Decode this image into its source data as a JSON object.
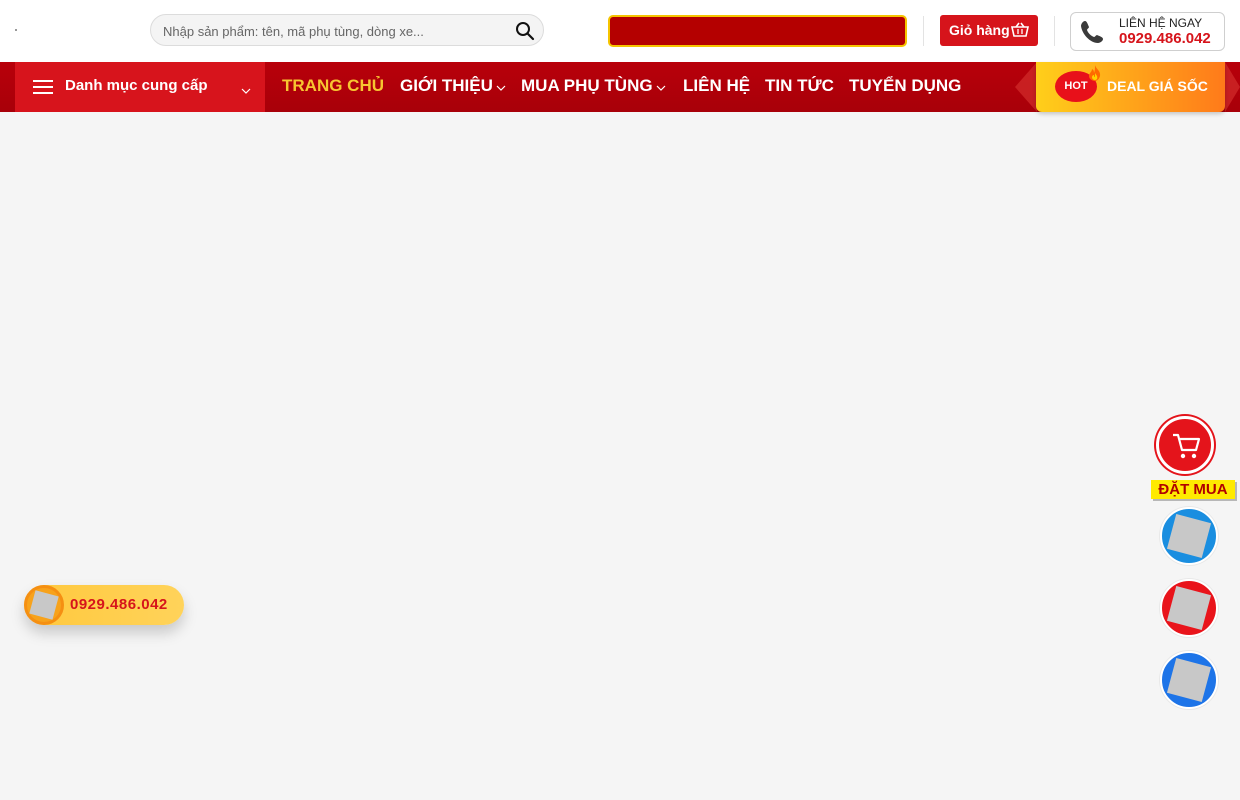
{
  "header": {
    "search_placeholder": "Nhập sản phẩm: tên, mã phụ tùng, dòng xe...",
    "cart_label": "Giỏ hàng",
    "contact_label": "LIÊN HỆ NGAY",
    "contact_number": "0929.486.042"
  },
  "navbar": {
    "category_label": "Danh mục cung cấp",
    "items": [
      {
        "label": "TRANG CHỦ",
        "active": true
      },
      {
        "label": "GIỚI THIỆU",
        "dropdown": true
      },
      {
        "label": "MUA PHỤ TÙNG",
        "dropdown": true
      },
      {
        "label": "LIÊN HỆ"
      },
      {
        "label": "TIN TỨC"
      },
      {
        "label": "TUYỂN DỤNG"
      }
    ],
    "deal_badge": "HOT",
    "deal_label": "DEAL GIÁ SỐC"
  },
  "floating": {
    "phone_number": "0929.486.042",
    "order_label": "ĐẶT MUA",
    "buttons": [
      {
        "icon": "zalo-icon",
        "color": "#1a8ee0"
      },
      {
        "icon": "youtube-icon",
        "color": "#e9141b"
      },
      {
        "icon": "messenger-icon",
        "color": "#1d74e8"
      }
    ]
  },
  "colors": {
    "brand_red": "#d6141b",
    "nav_red": "#b0000a",
    "accent_yellow": "#f7c531"
  }
}
